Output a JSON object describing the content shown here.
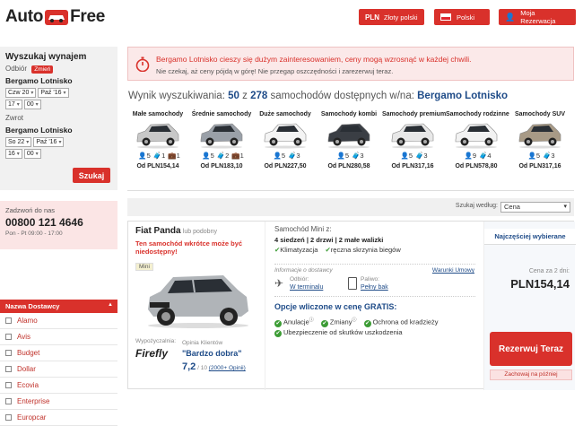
{
  "header": {
    "logo_left": "Auto",
    "logo_right": "Free",
    "currency_code": "PLN",
    "currency_label": "Złoty polski",
    "language_label": "Polski",
    "account_label": "Moja Rezerwacja"
  },
  "search": {
    "title": "Wyszukaj wynajem",
    "pickup_label": "Odbiór",
    "change_label": "Zmień",
    "pickup_location": "Bergamo Lotnisko",
    "pickup_day": "Czw 20",
    "pickup_month": "Paź '16",
    "pickup_hour": "17",
    "pickup_min": "00",
    "return_label": "Zwrot",
    "return_location": "Bergamo Lotnisko",
    "return_day": "So 22",
    "return_month": "Paź '16",
    "return_hour": "16",
    "return_min": "00",
    "search_button": "Szukaj"
  },
  "contact": {
    "label": "Zadzwoń do nas",
    "phone": "00800 121 4646",
    "hours": "Pon - Pt 09:00 - 17:00"
  },
  "filter": {
    "title": "Nazwa Dostawcy",
    "providers": [
      "Alamo",
      "Avis",
      "Budget",
      "Dollar",
      "Ecovia",
      "Enterprise",
      "Europcar"
    ]
  },
  "alert": {
    "line1": "Bergamo Lotnisko cieszy się dużym zainteresowaniem, ceny mogą wzrosnąć w każdej chwili.",
    "line2": "Nie czekaj, aż ceny pójdą w górę! Nie przegap oszczędności i zarezerwuj teraz."
  },
  "results": {
    "prefix": "Wynik wyszukiwania:",
    "shown": "50",
    "of": "z",
    "total": "278",
    "suffix": "samochodów dostępnych w/na:",
    "location": "Bergamo Lotnisko"
  },
  "categories": [
    {
      "name": "Małe samochody",
      "seats": "5",
      "bags_big": "1",
      "bags_small": "1",
      "price": "Od PLN154,14",
      "color": "#c8c8c8"
    },
    {
      "name": "Średnie samochody",
      "seats": "5",
      "bags_big": "2",
      "bags_small": "1",
      "price": "Od PLN183,10",
      "color": "#9aa0a8"
    },
    {
      "name": "Duże samochody",
      "seats": "5",
      "bags_big": "3",
      "bags_small": "",
      "price": "Od PLN227,50",
      "color": "#f4f4f4"
    },
    {
      "name": "Samochody kombi",
      "seats": "5",
      "bags_big": "3",
      "bags_small": "",
      "price": "Od PLN280,58",
      "color": "#3a3e44"
    },
    {
      "name": "Samochody premium",
      "seats": "5",
      "bags_big": "3",
      "bags_small": "",
      "price": "Od PLN317,16",
      "color": "#e8e8e8"
    },
    {
      "name": "Samochody rodzinne",
      "seats": "9",
      "bags_big": "4",
      "bags_small": "",
      "price": "Od PLN578,80",
      "color": "#f2f2f2"
    },
    {
      "name": "Samochody SUV",
      "seats": "5",
      "bags_big": "3",
      "bags_small": "",
      "price": "Od PLN317,16",
      "color": "#a89a86"
    }
  ],
  "sort": {
    "label": "Szukaj według:",
    "value": "Cena"
  },
  "offer": {
    "car_name": "Fiat Panda",
    "or_similar": "lub podobny",
    "urgency": "Ten samochód wkrótce może być niedostępny!",
    "size_badge": "Mini",
    "rented_from": "Wypożyczalnia:",
    "supplier": "Firefly",
    "opinion_label": "Opinia Klientów",
    "opinion_text": "\"Bardzo dobra\"",
    "rating": "7,2",
    "rating_scale": "/ 10",
    "rating_count": "(2000+ Opinii)",
    "class_title": "Samochód Mini z:",
    "spec_seats": "4 siedzeń",
    "spec_doors": "2 drzwi",
    "spec_bags": "2 małe walizki",
    "feature_ac": "Klimatyzacja",
    "feature_gear": "ręczna skrzynia biegów",
    "supplier_info_label": "Informacje o dostawcy",
    "rental_terms": "Warunki Umowy",
    "pickup_label": "Odbiór:",
    "pickup_value": "W terminalu",
    "fuel_label": "Paliwo:",
    "fuel_value": "Pełny bak",
    "included_title": "Opcje wliczone w cenę GRATIS:",
    "inc_cancel": "Anulacje",
    "inc_changes": "Zmiany",
    "inc_theft": "Ochrona od kradzieży",
    "inc_damage": "Ubezpieczenie od skutków uszkodzenia",
    "popular_badge": "Najczęściej wybierane",
    "price_label": "Cena za 2 dni:",
    "price": "PLN154,14",
    "book_button": "Rezerwuj Teraz",
    "later_button": "Zachowaj na później"
  }
}
